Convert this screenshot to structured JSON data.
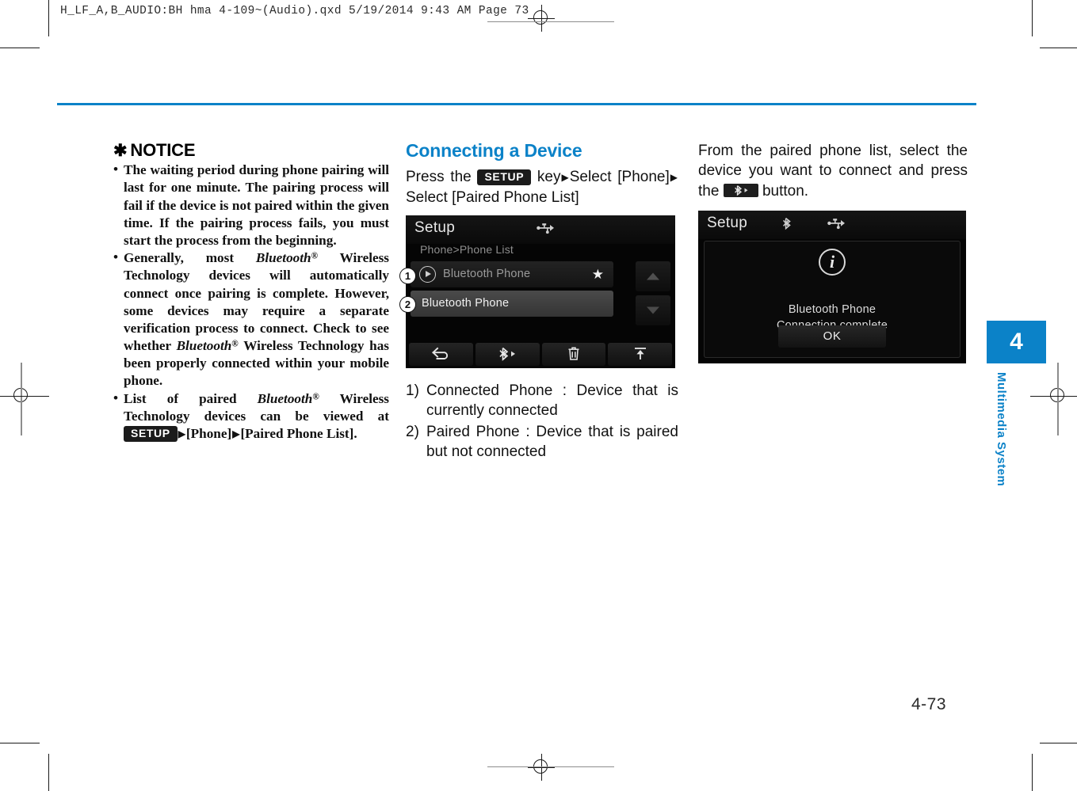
{
  "prepress": {
    "header_line": "H_LF_A,B_AUDIO:BH hma 4-109~(Audio).qxd  5/19/2014  9:43 AM  Page 73"
  },
  "chapter": {
    "number": "4",
    "label": "Multimedia System",
    "accent_color": "#0b82c8"
  },
  "page": {
    "number": "4-73"
  },
  "notice": {
    "title": "NOTICE",
    "title_marker": "✱",
    "items": [
      {
        "parts": [
          {
            "type": "text",
            "value": "The waiting period during phone pairing will last for one minute. The pairing process will fail if the device is not paired within the given time. If the pairing process fails, you must start the process from the beginning."
          }
        ]
      },
      {
        "parts": [
          {
            "type": "text",
            "value": "Generally, most "
          },
          {
            "type": "bluetooth",
            "value": "Bluetooth"
          },
          {
            "type": "text",
            "value": " Wireless Technology devices will automatically connect once pairing is complete. However, some devices may require a separate verification process to connect. Check to see whether "
          },
          {
            "type": "bluetooth",
            "value": "Bluetooth"
          },
          {
            "type": "text",
            "value": " Wireless Technology has been properly connected within your mobile phone."
          }
        ]
      },
      {
        "parts": [
          {
            "type": "text",
            "value": "List of paired "
          },
          {
            "type": "bluetooth",
            "value": "Bluetooth"
          },
          {
            "type": "text",
            "value": " Wireless Technology devices can be viewed at "
          },
          {
            "type": "key",
            "value": "SETUP"
          },
          {
            "type": "arrow",
            "value": "▶"
          },
          {
            "type": "text",
            "value": "[Phone]"
          },
          {
            "type": "arrow",
            "value": "▶"
          },
          {
            "type": "text",
            "value": "[Paired Phone List]."
          }
        ]
      }
    ]
  },
  "connecting_section": {
    "heading": "Connecting a Device",
    "instruction": {
      "before_key": "Press the",
      "key_label": "SETUP",
      "after_key": "key",
      "arrow": "▶",
      "step2": "Select [Phone]",
      "step3": "Select [Paired Phone List]"
    },
    "device_screen": {
      "title": "Setup",
      "breadcrumb": "Phone>Phone List",
      "status_icons": [
        "usb-icon"
      ],
      "rows": [
        {
          "callout": "1",
          "label": "Bluetooth Phone",
          "state": "connected",
          "icons": [
            "play-icon",
            "star-icon"
          ]
        },
        {
          "callout": "2",
          "label": "Bluetooth Phone",
          "state": "paired",
          "icons": []
        }
      ],
      "scroll": [
        "scroll-up-icon",
        "scroll-down-icon"
      ],
      "toolbar": [
        "back-icon",
        "bluetooth-connect-icon",
        "delete-icon",
        "upload-icon"
      ]
    },
    "legend": [
      {
        "number": "1)",
        "text": "Connected Phone : Device that is currently connected"
      },
      {
        "number": "2)",
        "text": "Paired Phone : Device that is paired but not connected"
      }
    ]
  },
  "connect_result": {
    "paragraph_before": "From the paired phone list, select the device you want to connect and press the",
    "button_icon": "bluetooth-connect-icon",
    "paragraph_after": "button.",
    "device_screen": {
      "title": "Setup",
      "status_icons": [
        "bluetooth-icon",
        "usb-icon"
      ],
      "dialog": {
        "icon": "info-icon",
        "icon_glyph": "i",
        "message_line1": "Bluetooth Phone",
        "message_line2": "Connection complete",
        "ok_label": "OK"
      }
    }
  }
}
